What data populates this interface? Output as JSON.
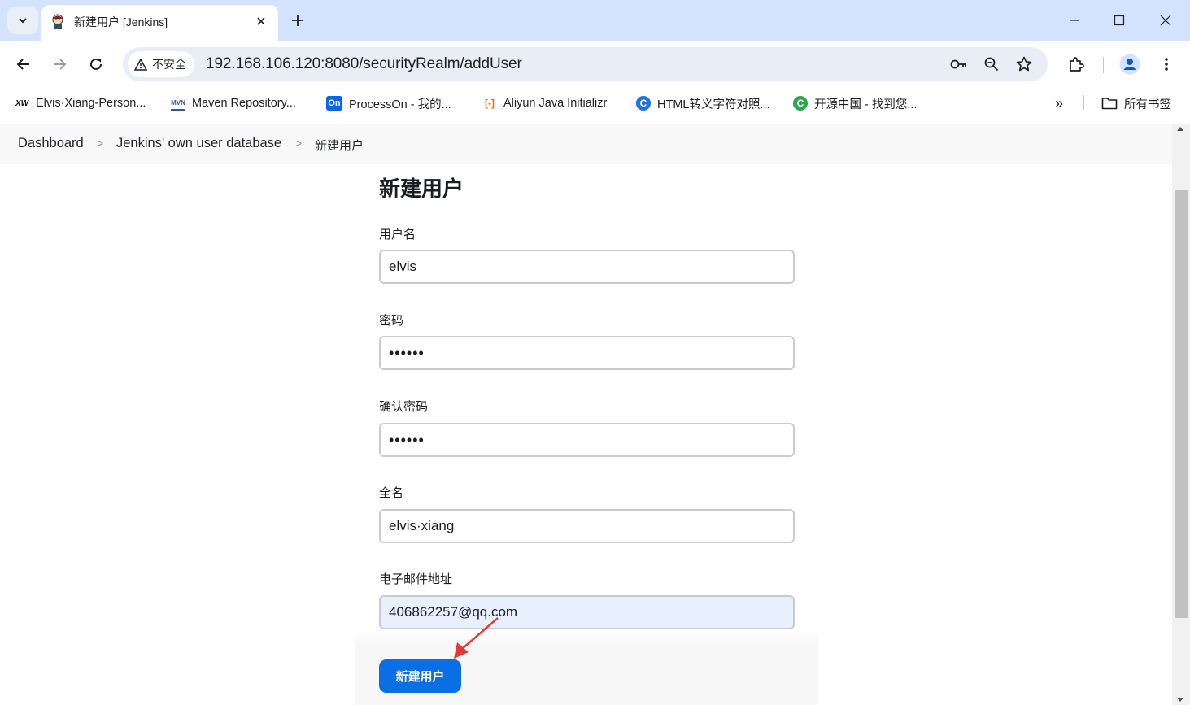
{
  "browser": {
    "tab": {
      "title": "新建用户 [Jenkins]"
    },
    "address": {
      "security_label": "不安全",
      "url": "192.168.106.120:8080/securityRealm/addUser"
    },
    "bookmarks": [
      {
        "icon_text": "XW",
        "label": "Elvis·Xiang-Person..."
      },
      {
        "icon_text": "MVN",
        "label": "Maven Repository..."
      },
      {
        "icon_text": "On",
        "label": "ProcessOn - 我的..."
      },
      {
        "icon_text": "[-]",
        "label": "Aliyun Java Initializr"
      },
      {
        "icon_text": "C",
        "label": "HTML转义字符对照..."
      },
      {
        "icon_text": "C",
        "label": "开源中国 - 找到您..."
      }
    ],
    "bookmarks_overflow": "»",
    "all_bookmarks": "所有书签"
  },
  "breadcrumb": {
    "items": [
      "Dashboard",
      "Jenkins' own user database",
      "新建用户"
    ]
  },
  "form": {
    "title": "新建用户",
    "fields": [
      {
        "label": "用户名",
        "value": "elvis"
      },
      {
        "label": "密码",
        "value": "••••••"
      },
      {
        "label": "确认密码",
        "value": "••••••"
      },
      {
        "label": "全名",
        "value": "elvis·xiang"
      },
      {
        "label": "电子邮件地址",
        "value": "406862257@qq.com"
      }
    ],
    "submit_label": "新建用户"
  },
  "colors": {
    "primary_button": "#0b6fe4",
    "annotation_arrow": "#e53935",
    "tabstrip": "#d3e3fd"
  }
}
